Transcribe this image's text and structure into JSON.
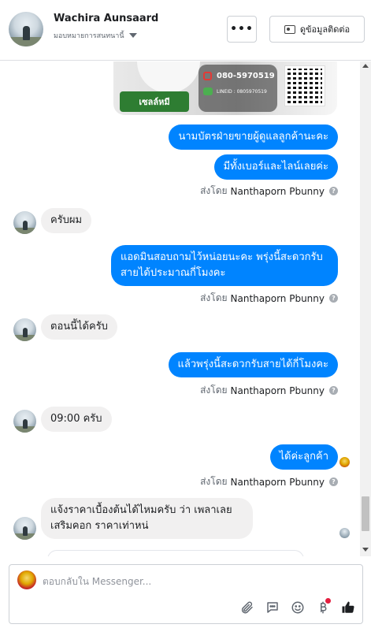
{
  "header": {
    "contact_name": "Wachira Aunsaard",
    "status_label": "มอบหมายการสนทนานี้",
    "more_label": "•••",
    "contact_info_label": "ดูข้อมูลติดต่อ"
  },
  "shared_image": {
    "sell_label": "เซลล์หมี",
    "phone": "080-5970519",
    "line_id": "LINEID : 0805970519"
  },
  "messages": [
    {
      "id": "m1",
      "direction": "out",
      "text": "นามบัตรฝ่ายขายผู้ดูแลลูกค้านะคะ"
    },
    {
      "id": "m2",
      "direction": "out",
      "text": "มีทั้งเบอร์และไลน์เลยค่ะ"
    },
    {
      "id": "m3",
      "direction": "in",
      "text": "ครับผม"
    },
    {
      "id": "m4",
      "direction": "out",
      "text": "แอดมินสอบถามไว้หน่อยนะคะ พรุ่งนี้สะดวกรับ สายได้ประมาณกี่โมงคะ"
    },
    {
      "id": "m5",
      "direction": "in",
      "text": "ตอนนี้ได้ครับ"
    },
    {
      "id": "m6",
      "direction": "out",
      "text": "แล้วพรุ่งนี้สะดวกรับสายได้กี่โมงคะ"
    },
    {
      "id": "m7",
      "direction": "in",
      "text": "09:00 ครับ"
    },
    {
      "id": "m8",
      "direction": "out",
      "text": "ได้ค่ะลูกค้า"
    },
    {
      "id": "m9",
      "direction": "in",
      "text": "แจ้งราคาเบื้องต้นได้ไหมครับ ว่า เพลาเลย เสริมคอก ราคาเท่าหน่"
    }
  ],
  "sent_by": {
    "prefix": "ส่งโดย",
    "name": "Nanthaporn Pbunny",
    "help": "?"
  },
  "composer": {
    "placeholder": "ตอบกลับใน Messenger..."
  },
  "icons": [
    "paperclip-icon",
    "saved-reply-icon",
    "emoji-icon",
    "currency-icon",
    "like-icon"
  ]
}
